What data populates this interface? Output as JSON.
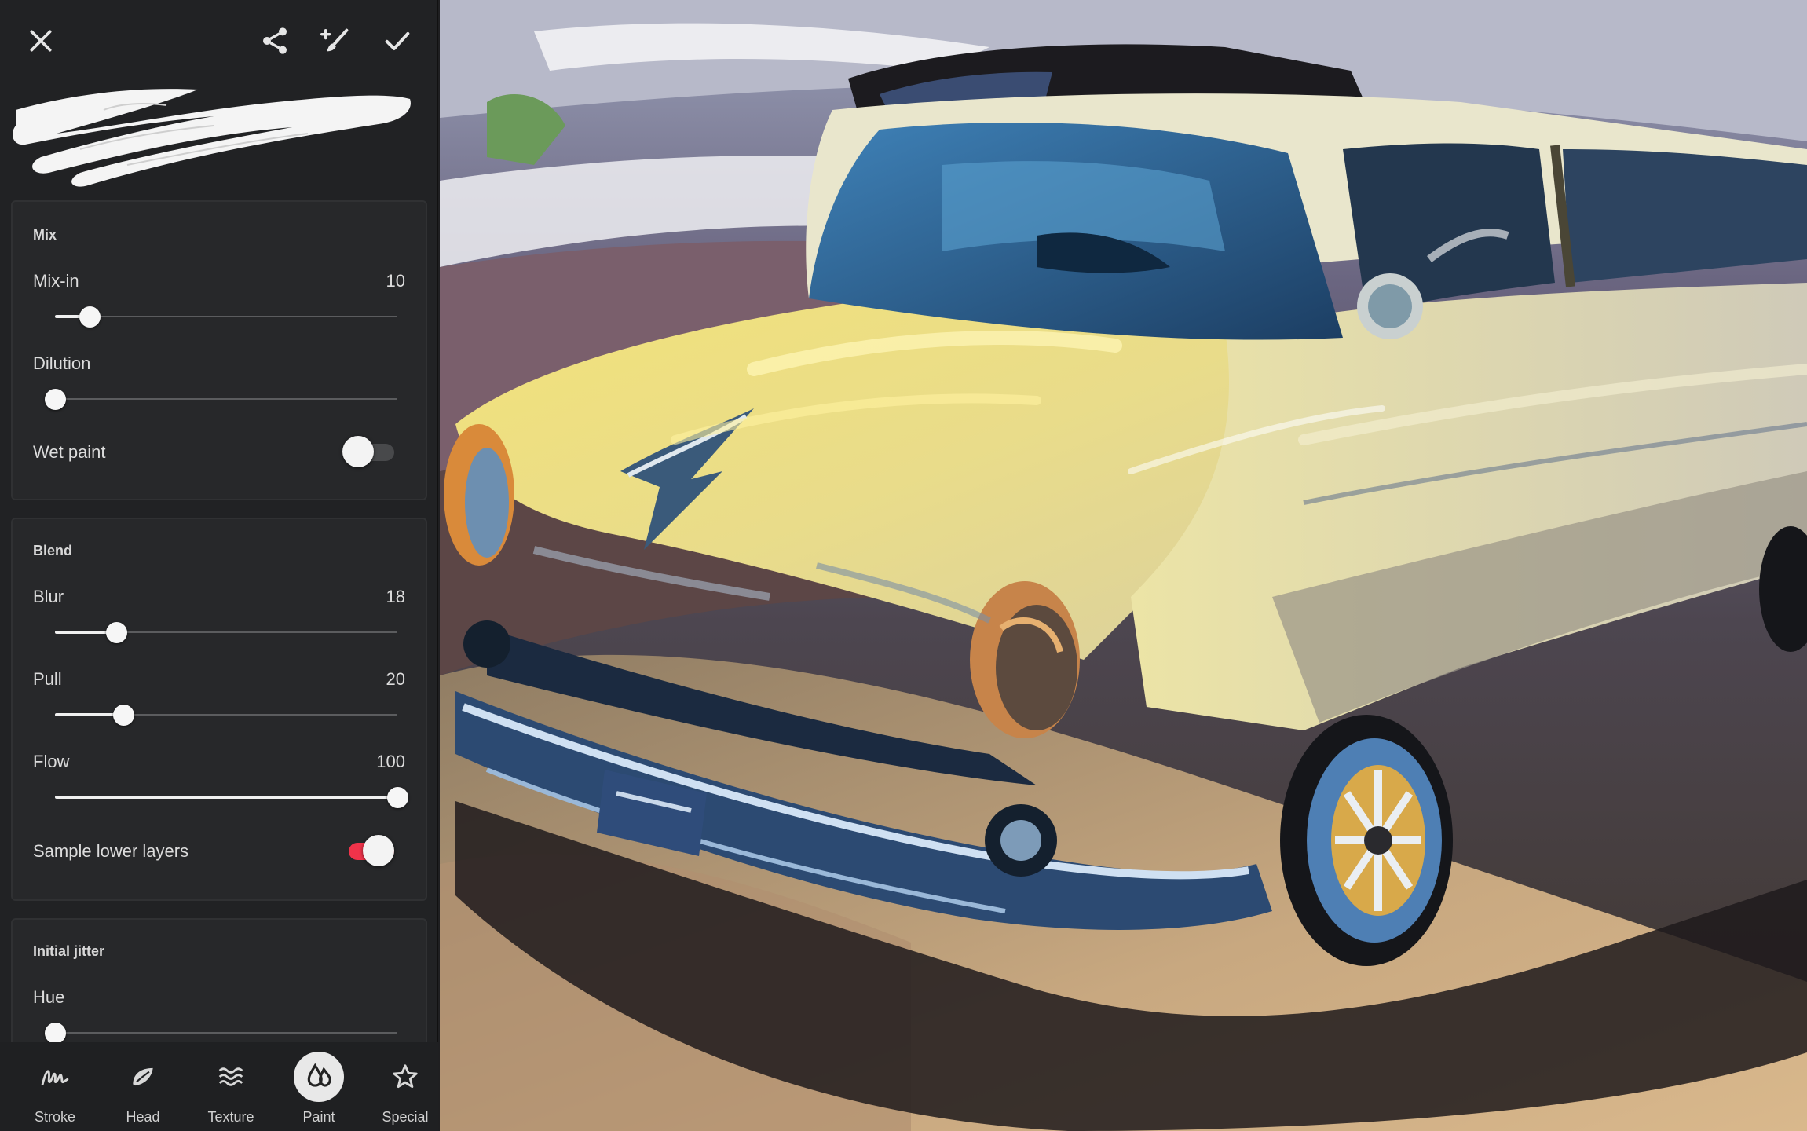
{
  "toolbar": {
    "close_icon": "close-icon",
    "share_icon": "share-icon",
    "brush_add_icon": "brush-plus-icon",
    "confirm_icon": "check-icon"
  },
  "sections": [
    {
      "title": "Mix",
      "sliders": [
        {
          "label": "Mix-in",
          "value": "10",
          "level": 0.1
        },
        {
          "label": "Dilution",
          "value": "",
          "level": 0.0
        }
      ],
      "toggle": {
        "label": "Wet paint",
        "on": false
      }
    },
    {
      "title": "Blend",
      "sliders": [
        {
          "label": "Blur",
          "value": "18",
          "level": 0.18
        },
        {
          "label": "Pull",
          "value": "20",
          "level": 0.2
        },
        {
          "label": "Flow",
          "value": "100",
          "level": 1.0
        }
      ],
      "toggle": {
        "label": "Sample lower layers",
        "on": true
      }
    },
    {
      "title": "Initial jitter",
      "sliders": [
        {
          "label": "Hue",
          "value": "",
          "level": 0.0
        }
      ]
    }
  ],
  "bottom_nav": [
    {
      "label": "Stroke",
      "icon": "stroke-icon",
      "active": false
    },
    {
      "label": "Head",
      "icon": "brush-head-icon",
      "active": false
    },
    {
      "label": "Texture",
      "icon": "texture-icon",
      "active": false
    },
    {
      "label": "Paint",
      "icon": "paint-drops-icon",
      "active": true
    },
    {
      "label": "Special",
      "icon": "star-icon",
      "active": false
    }
  ],
  "colors": {
    "accent": "#f0334a",
    "panel": "#212224",
    "card": "#27282a"
  }
}
